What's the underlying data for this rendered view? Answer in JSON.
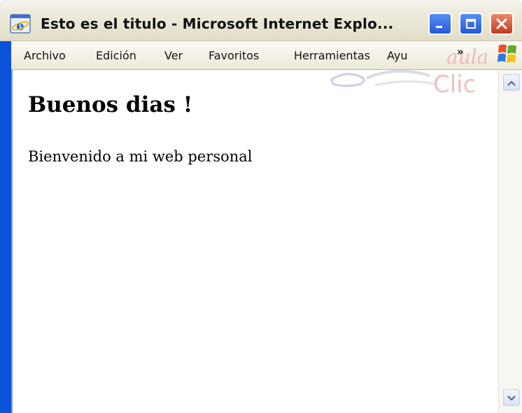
{
  "window": {
    "title": "Esto es el titulo - Microsoft Internet Explo..."
  },
  "menubar": {
    "items": [
      "Archivo",
      "Edición",
      "Ver",
      "Favoritos",
      "Herramientas",
      "Ayu"
    ],
    "overflow": "»"
  },
  "page": {
    "heading": "Buenos dias !",
    "paragraph": "Bienvenido a mi web personal"
  },
  "logo": {
    "aula": "aula",
    "clic": "Clic"
  },
  "icons": {
    "app": "internet-explorer-icon",
    "minimize": "minimize-icon",
    "maximize": "maximize-icon",
    "close": "close-icon",
    "flag": "windows-flag-icon",
    "scroll_up": "scroll-up-icon",
    "scroll_down": "scroll-down-icon"
  },
  "colors": {
    "titlebar": "#ece9d8",
    "close_button": "#c4391c",
    "window_button": "#2559d6",
    "logo_tint": "#d96a6a"
  }
}
